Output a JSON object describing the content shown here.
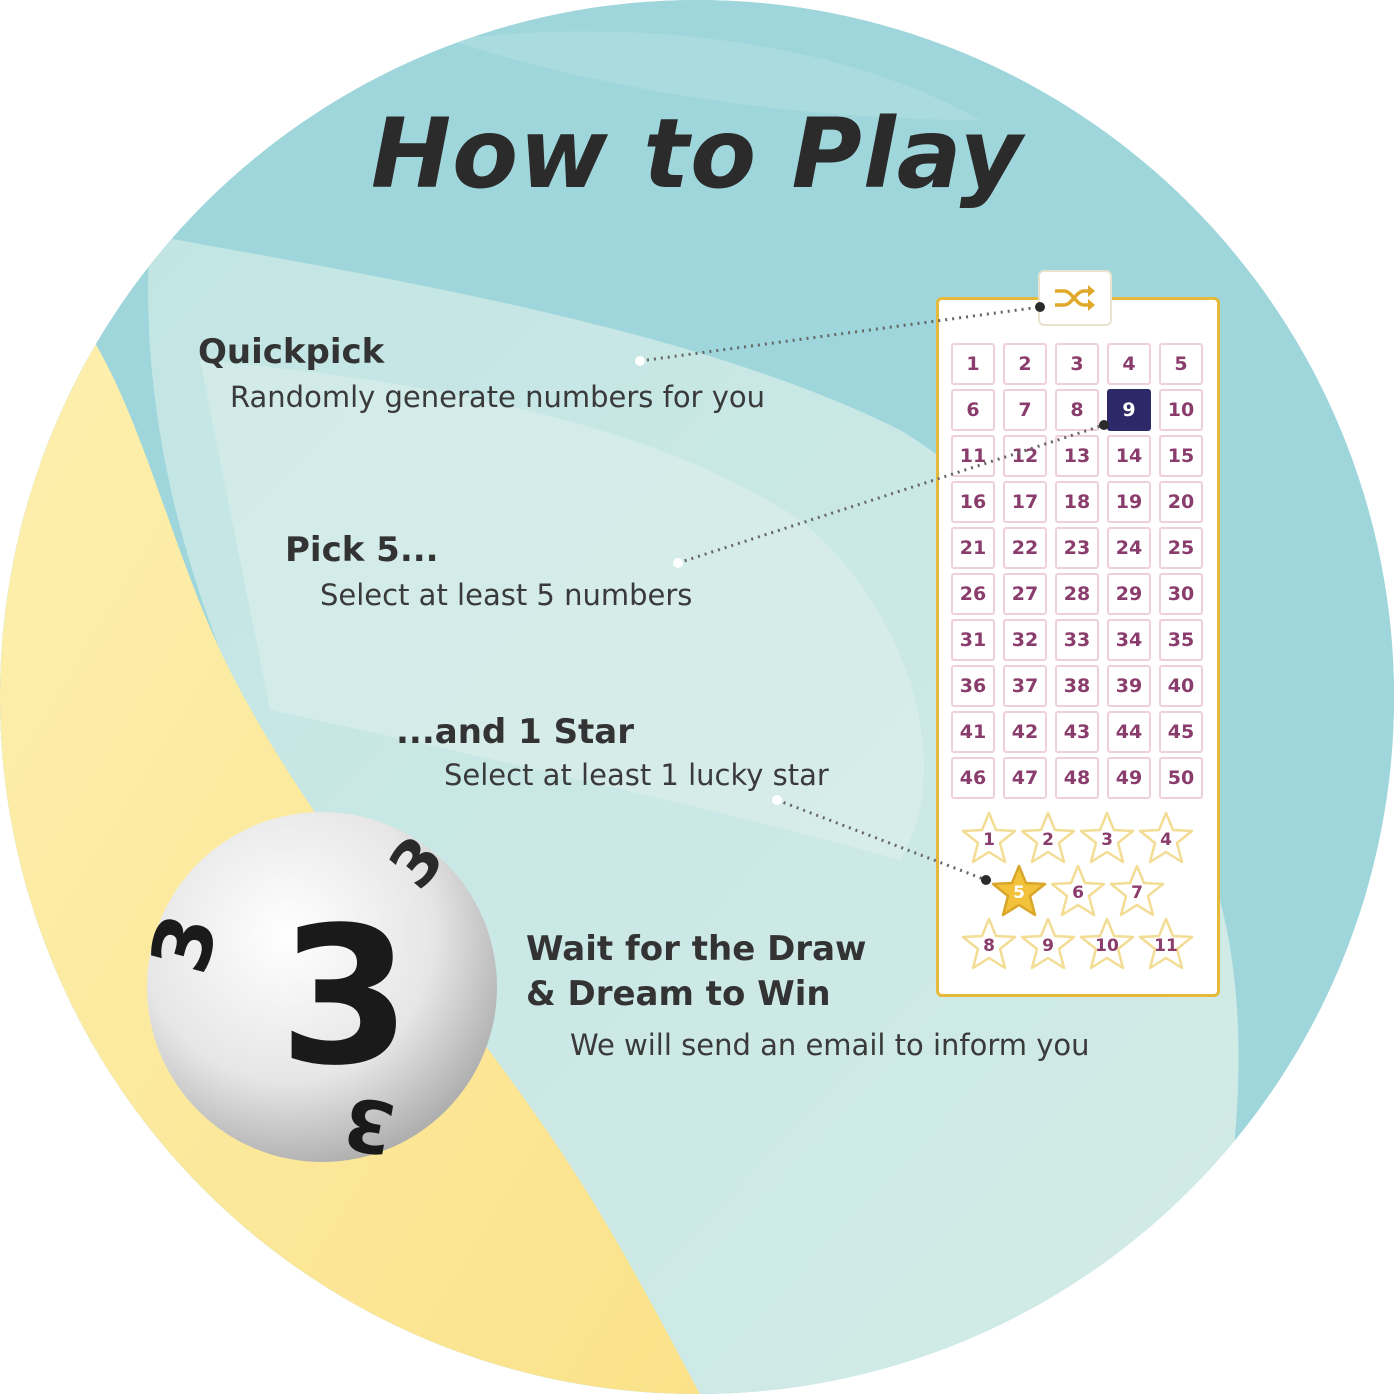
{
  "title": "How to Play",
  "steps": {
    "quickpick": {
      "title": "Quickpick",
      "desc": "Randomly generate numbers for you"
    },
    "pick5": {
      "title": "Pick 5...",
      "desc": "Select at least 5 numbers"
    },
    "star": {
      "title": "...and 1 Star",
      "desc": "Select at least 1 lucky star"
    },
    "draw": {
      "title_line1": "Wait for the Draw",
      "title_line2": "& Dream to Win",
      "desc": "We will send an email to inform you"
    }
  },
  "ticket": {
    "numbers": [
      "1",
      "2",
      "3",
      "4",
      "5",
      "6",
      "7",
      "8",
      "9",
      "10",
      "11",
      "12",
      "13",
      "14",
      "15",
      "16",
      "17",
      "18",
      "19",
      "20",
      "21",
      "22",
      "23",
      "24",
      "25",
      "26",
      "27",
      "28",
      "29",
      "30",
      "31",
      "32",
      "33",
      "34",
      "35",
      "36",
      "37",
      "38",
      "39",
      "40",
      "41",
      "42",
      "43",
      "44",
      "45",
      "46",
      "47",
      "48",
      "49",
      "50"
    ],
    "selected_number": "9",
    "stars": [
      "1",
      "2",
      "3",
      "4",
      "5",
      "6",
      "7",
      "8",
      "9",
      "10",
      "11"
    ],
    "selected_star": "5",
    "quickpick_icon": "shuffle-icon"
  },
  "ball": {
    "number": "3"
  },
  "colors": {
    "teal_bg": "#9fd6dc",
    "yellow_bg": "#fbe79a",
    "ticket_border": "#e6b93a",
    "number_text": "#8a3d6c",
    "selected_number_bg": "#2d2868",
    "selected_star_fill": "#f2c23a",
    "star_outline": "#f3dc93"
  }
}
